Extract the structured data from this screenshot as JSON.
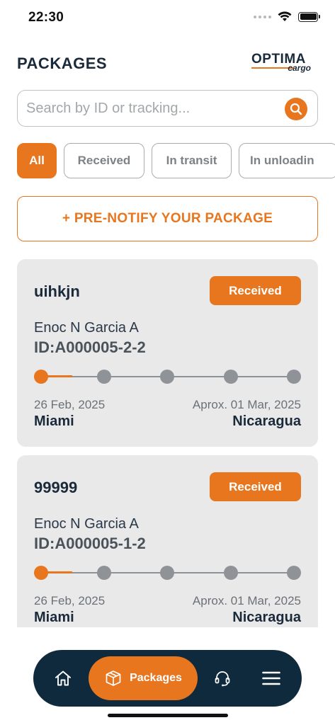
{
  "status_bar": {
    "time": "22:30"
  },
  "header": {
    "title": "PACKAGES",
    "logo_main": "OPTIMA",
    "logo_sub": "cargo"
  },
  "search": {
    "placeholder": "Search by ID or tracking...",
    "value": ""
  },
  "filters": [
    {
      "label": "All",
      "active": true
    },
    {
      "label": "Received",
      "active": false
    },
    {
      "label": "In transit",
      "active": false
    },
    {
      "label": "In unloadin",
      "active": false
    }
  ],
  "prenotify_label": "+ PRE-NOTIFY YOUR PACKAGE",
  "packages": [
    {
      "name": "uihkjn",
      "status": "Received",
      "owner": "Enoc N Garcia A",
      "id": "ID:A000005-2-2",
      "progress_step": 1,
      "total_steps": 5,
      "date_start": "26 Feb, 2025",
      "date_end": "Aprox. 01 Mar, 2025",
      "origin": "Miami",
      "destination": "Nicaragua"
    },
    {
      "name": "99999",
      "status": "Received",
      "owner": "Enoc N Garcia A",
      "id": "ID:A000005-1-2",
      "progress_step": 1,
      "total_steps": 5,
      "date_start": "26 Feb, 2025",
      "date_end": "Aprox. 01 Mar, 2025",
      "origin": "Miami",
      "destination": "Nicaragua"
    }
  ],
  "bottom_nav": {
    "active_label": "Packages",
    "items": [
      "home-icon",
      "package-icon",
      "support-headset-icon",
      "menu-icon"
    ]
  },
  "colors": {
    "accent": "#e8761e",
    "navy": "#102a3d",
    "card_bg": "#e9e9ea"
  }
}
